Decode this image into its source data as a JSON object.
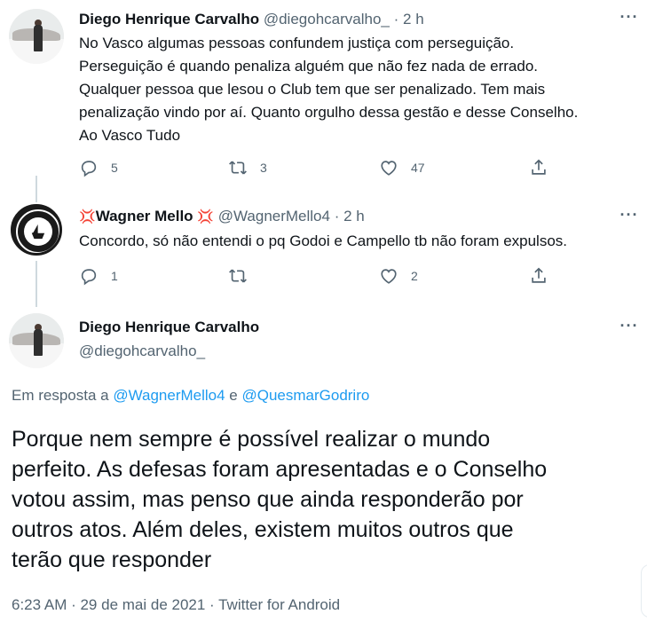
{
  "tweets": [
    {
      "name": "Diego Henrique Carvalho",
      "handle": "@diegohcarvalho_",
      "dot": "·",
      "time": "2 h",
      "lines": [
        "No Vasco algumas pessoas confundem justiça com perseguição.",
        "Perseguição é quando penaliza alguém que não fez nada de errado.",
        "Qualquer pessoa que lesou o Club tem que ser penalizado. Tem mais",
        "penalização vindo por aí. Quanto orgulho dessa gestão e desse Conselho.",
        "Ao Vasco Tudo"
      ],
      "replies": "5",
      "retweets": "3",
      "likes": "47"
    },
    {
      "name_prefix_emoji": "💢",
      "name": "Wagner Mello",
      "name_suffix_emoji": "💢",
      "handle": "@WagnerMello4",
      "dot": "·",
      "time": "2 h",
      "lines": [
        "Concordo, só não entendi o pq Godoi e Campello tb não foram expulsos."
      ],
      "replies": "1",
      "retweets": "",
      "likes": "2"
    }
  ],
  "focused": {
    "name": "Diego Henrique Carvalho",
    "handle": "@diegohcarvalho_",
    "reply_prefix": "Em resposta a ",
    "reply_user1": "@WagnerMello4",
    "reply_and": " e ",
    "reply_user2": "@QuesmarGodriro",
    "lines": [
      "Porque nem sempre é possível realizar o mundo",
      "perfeito. As defesas foram apresentadas e o Conselho",
      "votou assim, mas penso que ainda responderão por",
      "outros atos. Além deles, existem muitos outros que",
      "terão que responder"
    ],
    "meta": "6:23 AM · 29 de mai de 2021 · Twitter for Android"
  },
  "icons": {
    "reply": "reply-icon",
    "retweet": "retweet-icon",
    "like": "heart-icon",
    "share": "share-icon",
    "more": "more-icon"
  },
  "colors": {
    "link": "#1d9bf0",
    "muted": "#536471",
    "text": "#0f1419",
    "angry": "#e0245e"
  }
}
